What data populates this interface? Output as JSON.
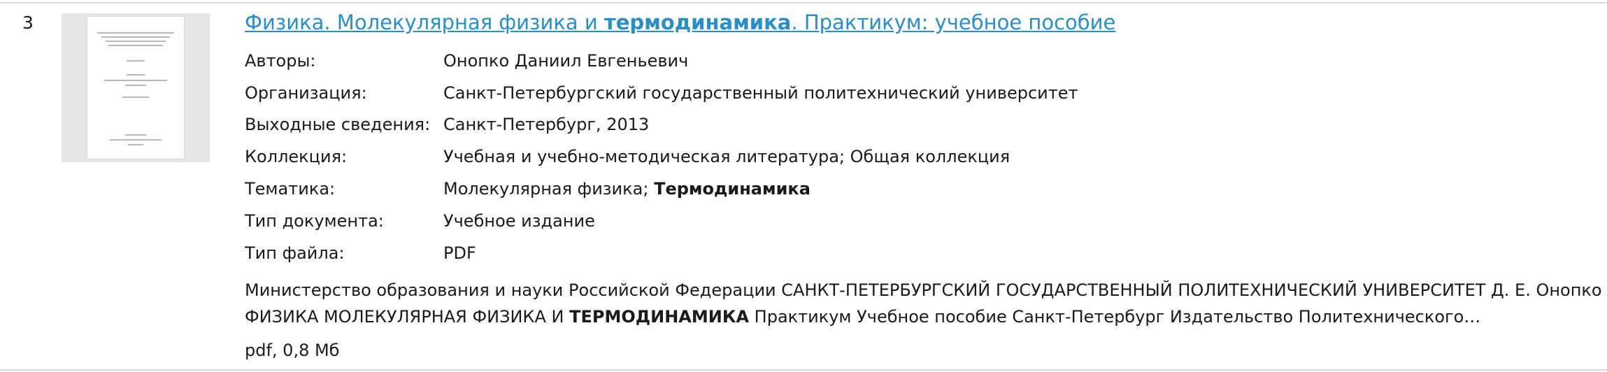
{
  "result": {
    "number": "3",
    "title": {
      "part1": "Физика. Молекулярная физика и ",
      "highlight": "термодинамика",
      "part2": ". Практикум: учебное пособие"
    },
    "meta": [
      {
        "label": "Авторы:",
        "value": "Онопко Даниил Евгеньевич"
      },
      {
        "label": "Организация:",
        "value": "Санкт-Петербургский государственный политехнический университет"
      },
      {
        "label": "Выходные сведения:",
        "value": "Санкт-Петербург, 2013"
      },
      {
        "label": "Коллекция:",
        "value": "Учебная и учебно-методическая литература; Общая коллекция"
      },
      {
        "label": "Тематика:",
        "value_plain": "Молекулярная физика; ",
        "value_bold": "Термодинамика"
      },
      {
        "label": "Тип документа:",
        "value": "Учебное издание"
      },
      {
        "label": "Тип файла:",
        "value": "PDF"
      }
    ],
    "snippet": {
      "line1": "Министерство образования и науки Российской Федерации САНКТ-ПЕТЕРБУРГСКИЙ ГОСУДАРСТВЕННЫЙ ПОЛИТЕХНИЧЕСКИЙ УНИВЕРСИТЕТ Д. Е. Онопко",
      "line2_before": "ФИЗИКА МОЛЕКУЛЯРНАЯ ФИЗИКА И ",
      "line2_bold": "ТЕРМОДИНАМИКА",
      "line2_after": " Практикум Учебное пособие Санкт-Петербург Издательство Политехнического…"
    },
    "file_info": "pdf, 0,8 Мб"
  }
}
